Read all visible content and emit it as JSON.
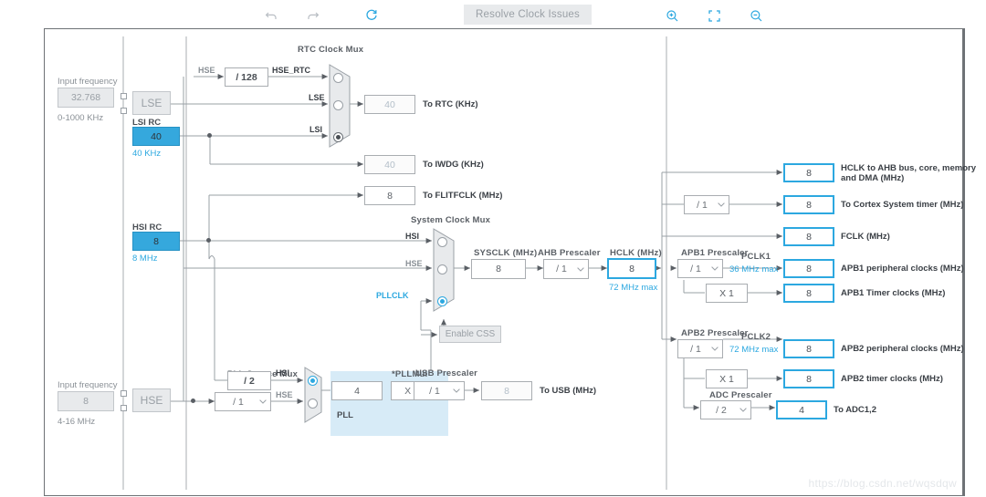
{
  "toolbar": {
    "undo_icon": "undo-icon",
    "redo_icon": "redo-icon",
    "reset_icon": "reset-refresh-icon",
    "resolve_label": "Resolve Clock Issues",
    "zoom_in_icon": "zoom-in-icon",
    "fit_icon": "fit-to-screen-icon",
    "zoom_out_icon": "zoom-out-icon"
  },
  "inputs": {
    "lse": {
      "caption": "Input frequency",
      "value": "32.768",
      "range": "0-1000 KHz",
      "osc_label": "LSE"
    },
    "hse": {
      "caption": "Input frequency",
      "value": "8",
      "range": "4-16 MHz",
      "osc_label": "HSE"
    }
  },
  "oscillators": {
    "lsi": {
      "title": "LSI RC",
      "value": "40",
      "unit": "40 KHz"
    },
    "hsi": {
      "title": "HSI RC",
      "value": "8",
      "unit": "8 MHz"
    }
  },
  "rtc_mux": {
    "title": "RTC Clock Mux",
    "hse_label": "HSE",
    "hse_div_label": "/ 128",
    "inputs": [
      "HSE_RTC",
      "LSE",
      "LSI"
    ],
    "selected_index": 2
  },
  "outputs": {
    "to_rtc": {
      "value": "40",
      "label": "To RTC (KHz)"
    },
    "to_iwdg": {
      "value": "40",
      "label": "To IWDG (KHz)"
    },
    "to_flitfclk": {
      "value": "8",
      "label": "To FLITFCLK (MHz)"
    },
    "to_usb": {
      "value": "8",
      "label": "To USB (MHz)"
    },
    "hclk_ahb": {
      "value": "8",
      "label": "HCLK to AHB bus, core, memory and DMA (MHz)"
    },
    "cortex_timer": {
      "value": "8",
      "label": "To Cortex System timer (MHz)"
    },
    "fclk": {
      "value": "8",
      "label": "FCLK (MHz)"
    },
    "apb1_periph": {
      "value": "8",
      "label": "APB1 peripheral clocks (MHz)"
    },
    "apb1_timer": {
      "value": "8",
      "label": "APB1 Timer clocks (MHz)"
    },
    "apb2_periph": {
      "value": "8",
      "label": "APB2 peripheral clocks (MHz)"
    },
    "apb2_timer": {
      "value": "8",
      "label": "APB2 timer clocks (MHz)"
    },
    "to_adc": {
      "value": "4",
      "label": "To ADC1,2"
    }
  },
  "system_clock_mux": {
    "title": "System Clock Mux",
    "inputs": [
      "HSI",
      "HSE",
      "PLLCLK"
    ],
    "selected_index": 2,
    "css_label": "Enable CSS"
  },
  "sysclk": {
    "title": "SYSCLK (MHz)",
    "value": "8"
  },
  "ahb_prescaler": {
    "title": "AHB Prescaler",
    "value": "/ 1"
  },
  "hclk": {
    "title": "HCLK (MHz)",
    "value": "8",
    "max": "72 MHz max"
  },
  "pll": {
    "source_mux_title": "PLL Source Mux",
    "hsi_div_label": "/ 2",
    "hse_div_label": "/ 1",
    "inputs": [
      "HSI",
      "HSE"
    ],
    "selected_index": 0,
    "region_label": "PLL",
    "pll_input_value": "4",
    "pllmul_title": "*PLLMul",
    "pllmul_value": "X 2"
  },
  "usb_prescaler": {
    "title": "USB Prescaler",
    "value": "/ 1"
  },
  "cortex_prescaler": {
    "value": "/ 1"
  },
  "apb1": {
    "prescaler_title": "APB1 Prescaler",
    "prescaler_value": "/ 1",
    "pclk_label": "PCLK1",
    "pclk_max": "36 MHz max",
    "timer_mul": "X 1"
  },
  "apb2": {
    "prescaler_title": "APB2 Prescaler",
    "prescaler_value": "/ 1",
    "pclk_label": "PCLK2",
    "pclk_max": "72 MHz max",
    "timer_mul": "X 1",
    "adc_prescaler_title": "ADC Prescaler",
    "adc_prescaler_value": "/ 2"
  },
  "watermark": "https://blog.csdn.net/wqsdqw",
  "colors": {
    "accent": "#2ca8e0",
    "source_fill": "#35a8dd",
    "pll_region": "#d7ebf7",
    "wire": "#8a9096"
  }
}
